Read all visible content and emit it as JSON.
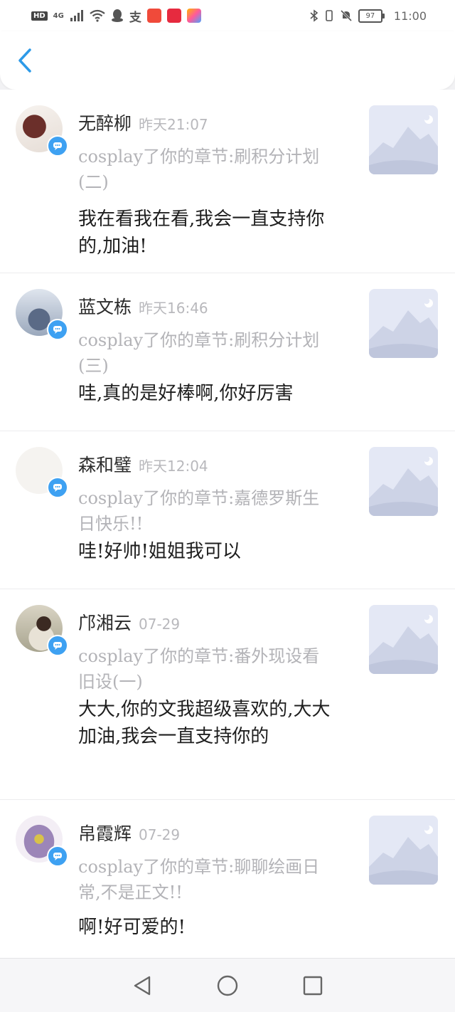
{
  "status_bar": {
    "hd_label": "HD",
    "network_label": "4G",
    "alipay_label": "支",
    "battery_level": "97",
    "time": "11:00"
  },
  "colors": {
    "accent": "#3ea1f2",
    "name_text": "#2b2b2b",
    "meta_text": "#b3b3b7",
    "comment_text": "#1e1e1e"
  },
  "comments": [
    {
      "name": "无醉柳",
      "time": "昨天21:07",
      "meta": "cosplay了你的章节:刷积分计划(二)",
      "comment": "我在看我在看,我会一直支持你的,加油!"
    },
    {
      "name": "蓝文栋",
      "time": "昨天16:46",
      "meta": "cosplay了你的章节:刷积分计划(三)",
      "comment": "哇,真的是好棒啊,你好厉害"
    },
    {
      "name": "森和璧",
      "time": "昨天12:04",
      "meta": "cosplay了你的章节:嘉德罗斯生日快乐!!",
      "comment": "哇!好帅!姐姐我可以"
    },
    {
      "name": "邝湘云",
      "time": "07-29",
      "meta": "cosplay了你的章节:番外现设看旧设(一)",
      "comment": "大大,你的文我超级喜欢的,大大加油,我会一直支持你的"
    },
    {
      "name": "帛霞辉",
      "time": "07-29",
      "meta": "cosplay了你的章节:聊聊绘画日常,不是正文!!",
      "comment": "啊!好可爱的!"
    }
  ],
  "icons": {
    "back": "chevron-left-icon",
    "badge": "comment-bubble-icon",
    "thumb": "mountain-placeholder-icon",
    "nav_back": "triangle-back-icon",
    "nav_home": "circle-home-icon",
    "nav_recent": "square-recent-icon"
  }
}
